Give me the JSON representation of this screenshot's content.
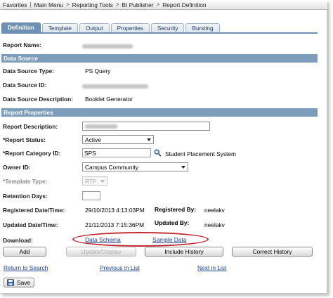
{
  "breadcrumb": [
    "Favorites",
    "Main Menu",
    "Reporting Tools",
    "BI Publisher",
    "Report Definition"
  ],
  "tabs": [
    {
      "label": "Definition",
      "active": true
    },
    {
      "label": "Template",
      "active": false
    },
    {
      "label": "Output",
      "active": false
    },
    {
      "label": "Properties",
      "active": false
    },
    {
      "label": "Security",
      "active": false
    },
    {
      "label": "Bursting",
      "active": false
    }
  ],
  "report_name": {
    "label": "Report Name:"
  },
  "data_source": {
    "header": "Data Source",
    "type_label": "Data Source Type:",
    "type_value": "PS Query",
    "id_label": "Data Source ID:",
    "desc_label": "Data Source Description:",
    "desc_value": "Booklet Generator"
  },
  "report_properties": {
    "header": "Report Properties",
    "description_label": "Report Description:",
    "status_label": "*Report Status:",
    "status_value": "Active",
    "category_label": "*Report Category ID:",
    "category_value": "SPS",
    "category_desc": "Student Placement System",
    "owner_label": "Owner ID:",
    "owner_value": "Campus Community",
    "template_type_label": "*Template Type:",
    "template_type_value": "RTF",
    "retention_label": "Retention Days:",
    "retention_value": "",
    "registered_label": "Registered Date/Time:",
    "registered_value": "29/10/2013  4:13:03PM",
    "registered_by_label": "Registered By:",
    "registered_by_value": "neelakv",
    "updated_label": "Updated Date/Time:",
    "updated_value": "21/11/2013  7:15:36PM",
    "updated_by_label": "Updated By:",
    "updated_by_value": "neelakv"
  },
  "download": {
    "label": "Download:",
    "data_schema": "Data Schema",
    "sample_data": "Sample Data",
    "highlight_color": "#c0262d"
  },
  "buttons": {
    "add": "Add",
    "update_display": "Update/Display",
    "include_history": "Include History",
    "correct_history": "Correct History"
  },
  "nav_links": {
    "return_to_search": "Return to Search",
    "previous_in_list": "Previous in List",
    "next_in_list": "Next in List"
  },
  "save": {
    "label": "Save",
    "icon": "save-icon"
  },
  "colors": {
    "section_header": "#7d9dbd",
    "active_tab": "#6f91b3",
    "link": "#1f3f93"
  }
}
